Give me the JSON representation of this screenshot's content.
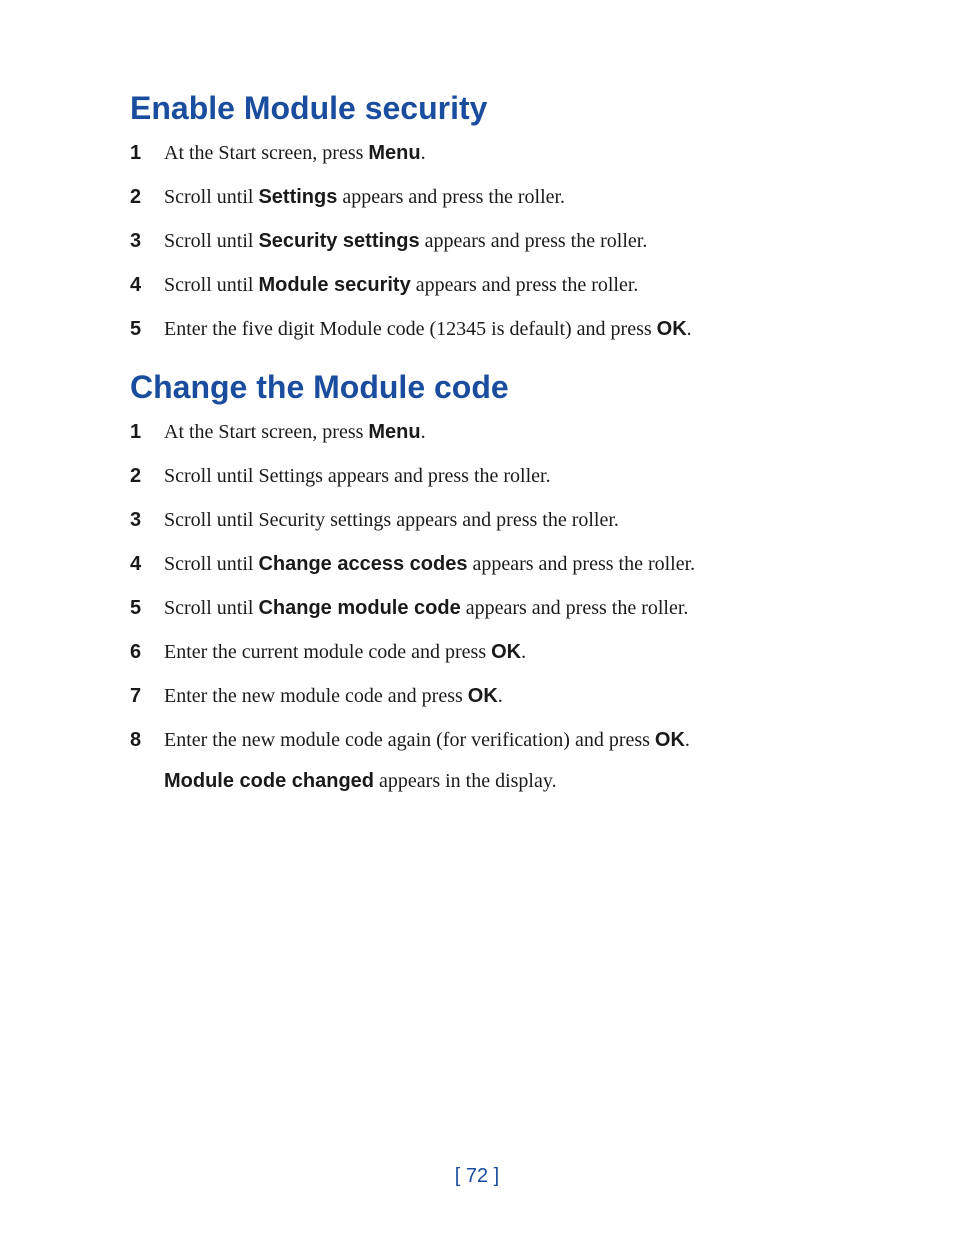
{
  "section1": {
    "heading": "Enable Module security",
    "steps": [
      {
        "num": "1",
        "parts": [
          "At the Start screen, press ",
          {
            "bold": "Menu"
          },
          "."
        ]
      },
      {
        "num": "2",
        "parts": [
          "Scroll until ",
          {
            "bold": "Settings"
          },
          " appears and press the roller."
        ]
      },
      {
        "num": "3",
        "parts": [
          "Scroll until ",
          {
            "bold": "Security settings"
          },
          " appears and press the roller."
        ]
      },
      {
        "num": "4",
        "parts": [
          "Scroll until ",
          {
            "bold": "Module security"
          },
          " appears and press the roller."
        ]
      },
      {
        "num": "5",
        "parts": [
          "Enter the five digit Module code (12345 is default) and press ",
          {
            "bold": "OK"
          },
          "."
        ]
      }
    ]
  },
  "section2": {
    "heading": "Change the Module code",
    "steps": [
      {
        "num": "1",
        "parts": [
          "At the Start screen, press ",
          {
            "bold": "Menu"
          },
          "."
        ]
      },
      {
        "num": "2",
        "parts": [
          "Scroll until Settings appears and press the roller."
        ]
      },
      {
        "num": "3",
        "parts": [
          "Scroll until Security settings appears and press the roller."
        ]
      },
      {
        "num": "4",
        "parts": [
          "Scroll until ",
          {
            "bold": "Change access codes"
          },
          " appears and press the roller."
        ]
      },
      {
        "num": "5",
        "parts": [
          "Scroll until ",
          {
            "bold": "Change module code"
          },
          " appears and press the roller."
        ]
      },
      {
        "num": "6",
        "parts": [
          "Enter the current module code and press ",
          {
            "bold": "OK"
          },
          "."
        ]
      },
      {
        "num": "7",
        "parts": [
          "Enter the new module code and press ",
          {
            "bold": "OK"
          },
          "."
        ]
      },
      {
        "num": "8",
        "parts": [
          "Enter the new module code again (for verification) and press ",
          {
            "bold": "OK"
          },
          "."
        ]
      }
    ],
    "trailing": [
      {
        "bold": "Module code changed"
      },
      " appears in the display."
    ]
  },
  "pageNumber": "[ 72 ]"
}
